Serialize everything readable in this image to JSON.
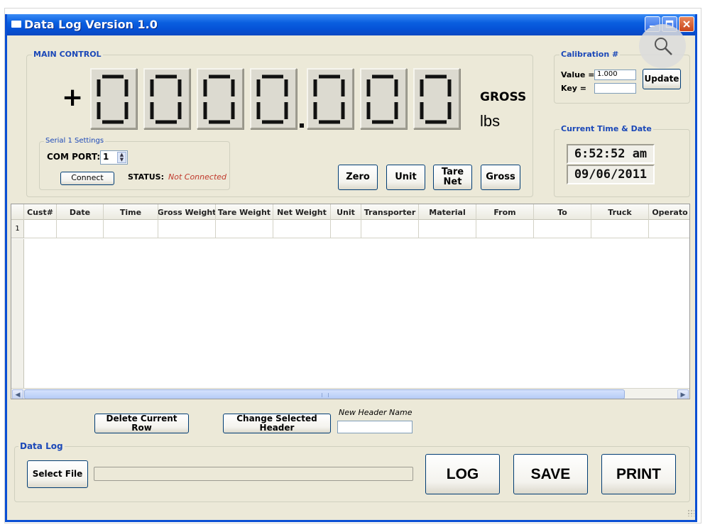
{
  "window": {
    "title": "Data Log Version 1.0"
  },
  "main_control": {
    "legend": "MAIN CONTROL",
    "sign": "+",
    "digits": [
      "0",
      "0",
      "0",
      "0",
      "0",
      "0",
      "0"
    ],
    "decimal_after_index": 3,
    "mode": "GROSS",
    "unit": "lbs",
    "serial": {
      "legend": "Serial 1 Settings",
      "com_port_label": "COM PORT:",
      "com_port_value": "1",
      "connect_label": "Connect",
      "status_label": "STATUS:",
      "status_value": "Not Connected"
    },
    "buttons": {
      "zero": "Zero",
      "unit": "Unit",
      "tare_net": "Tare Net",
      "gross": "Gross"
    }
  },
  "calibration": {
    "legend": "Calibration #",
    "value_label": "Value =",
    "value": "1.000",
    "key_label": "Key =",
    "key_value": "",
    "update_label": "Update"
  },
  "clock": {
    "legend": "Current Time & Date",
    "time": "6:52:52 am",
    "date": "09/06/2011"
  },
  "grid": {
    "columns": [
      "Cust#",
      "Date",
      "Time",
      "Gross Weight",
      "Tare Weight",
      "Net Weight",
      "Unit",
      "Transporter",
      "Material",
      "From",
      "To",
      "Truck",
      "Operato"
    ],
    "rows": [
      {
        "number": "1",
        "cells": [
          "",
          "",
          "",
          "",
          "",
          "",
          "",
          "",
          "",
          "",
          "",
          "",
          ""
        ]
      }
    ]
  },
  "actions": {
    "delete_row": "Delete Current Row",
    "change_header": "Change Selected Header",
    "new_header_label": "New Header Name",
    "new_header_value": ""
  },
  "data_log": {
    "legend": "Data Log",
    "select_file": "Select File",
    "file_path": "",
    "log": "LOG",
    "save": "SAVE",
    "print": "PRINT"
  },
  "colors": {
    "titlebar": "#0a5fe0",
    "legend_text": "#1b48b8",
    "status_error": "#c0392b",
    "window_bg": "#ece9d8"
  },
  "icons": {
    "search": "search-icon",
    "minimize": "minimize-icon",
    "maximize": "maximize-icon",
    "close": "close-icon"
  }
}
